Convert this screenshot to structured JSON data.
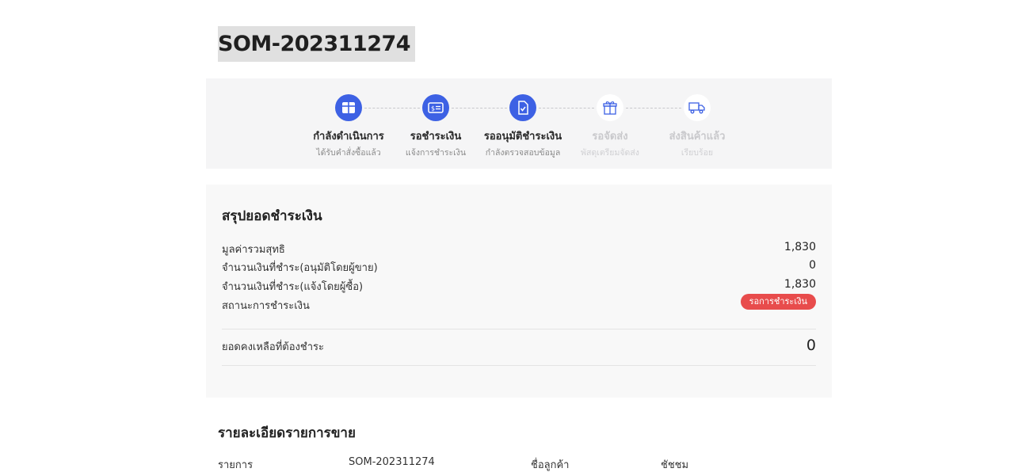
{
  "order": {
    "id": "SOM-202311274"
  },
  "steps": [
    {
      "label": "กำลังดำเนินการ",
      "sub": "ได้รับคำสั่งซื้อแล้ว",
      "icon": "box-icon",
      "active": true
    },
    {
      "label": "รอชำระเงิน",
      "sub": "แจ้งการชำระเงิน",
      "icon": "payment-card-icon",
      "active": true
    },
    {
      "label": "รออนุมัติชำระเงิน",
      "sub": "กำลังตรวจสอบข้อมูล",
      "icon": "document-check-icon",
      "active": true
    },
    {
      "label": "รอจัดส่ง",
      "sub": "พัสดุเตรียมจัดส่ง",
      "icon": "gift-box-icon",
      "active": false
    },
    {
      "label": "ส่งสินค้าแล้ว",
      "sub": "เรียบร้อย",
      "icon": "truck-icon",
      "active": false
    }
  ],
  "summary": {
    "title": "สรุปยอดชำระเงิน",
    "net_total_label": "มูลค่ารวมสุทธิ",
    "net_total_value": "1,830",
    "paid_seller_label": "จำนวนเงินที่ชำระ(อนุมัติโดยผู้ขาย)",
    "paid_seller_value": "0",
    "paid_buyer_label": "จำนวนเงินที่ชำระ(แจ้งโดยผู้ซื้อ)",
    "paid_buyer_value": "1,830",
    "status_label": "สถานะการชำระเงิน",
    "status_value": "รอการชำระเงิน",
    "balance_label": "ยอดคงเหลือที่ต้องชำระ",
    "balance_value": "0"
  },
  "details": {
    "title": "รายละเอียดรายการขาย",
    "item_label": "รายการ",
    "item_value": "SOM-202311274",
    "customer_label": "ชื่อลูกค้า",
    "customer_value": "ชัชชม"
  },
  "colors": {
    "accent": "#3d61e4",
    "status_badge": "#e84c4c",
    "panel_bg": "#f5f5f6"
  }
}
